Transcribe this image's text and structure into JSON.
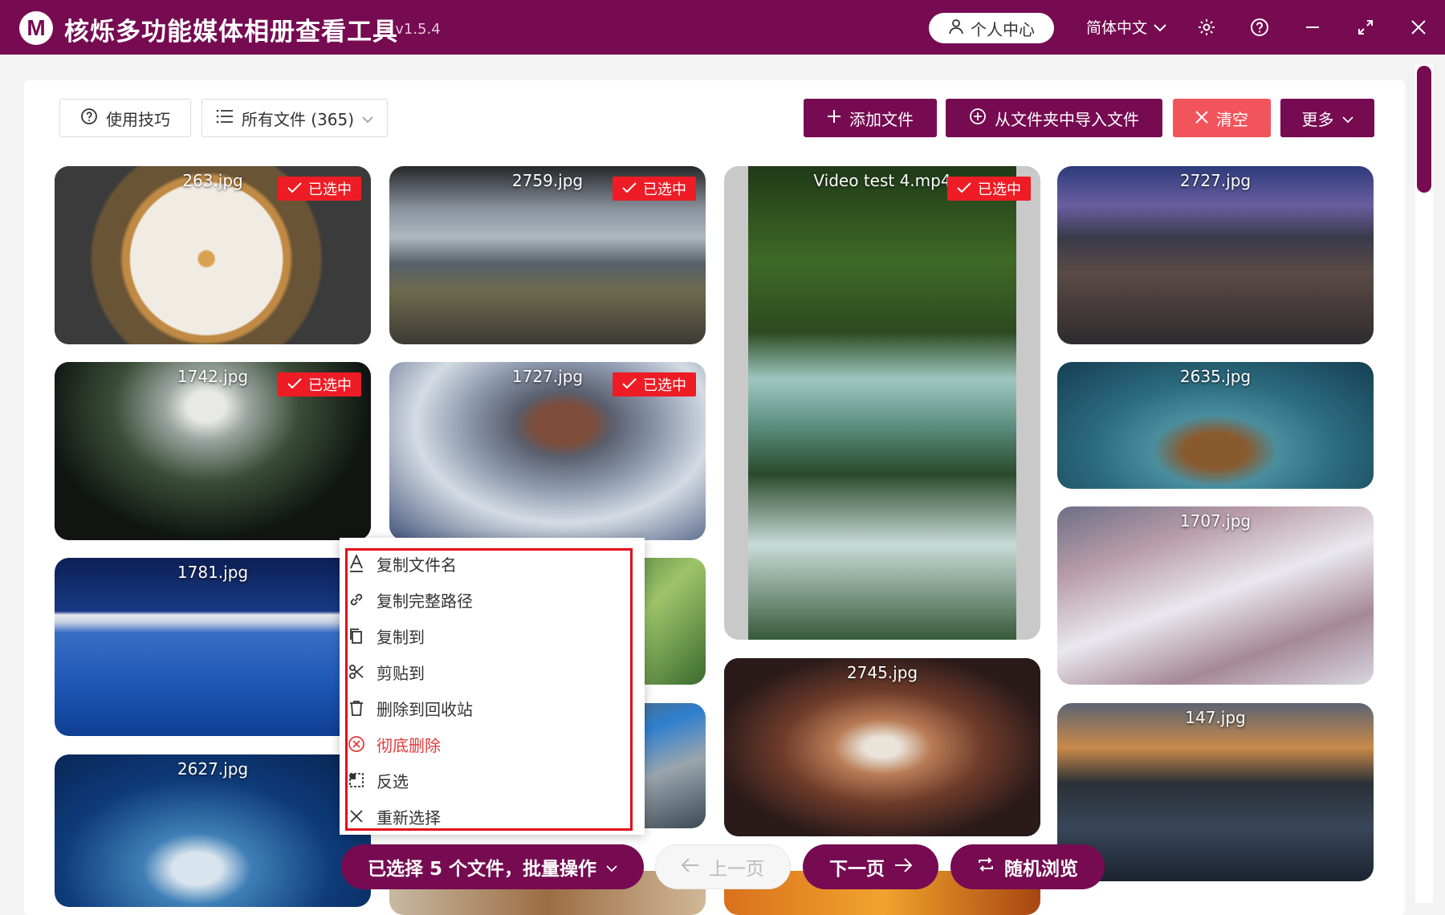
{
  "window": {
    "title": "核烁多功能媒体相册查看工具",
    "version": "- v1.5.4",
    "logo_letter": "M",
    "user_center": "个人中心",
    "language": "简体中文"
  },
  "toolbar": {
    "tips": "使用技巧",
    "filter": "所有文件 (365)",
    "add_files": "添加文件",
    "import_folder": "从文件夹中导入文件",
    "clear": "清空",
    "more": "更多"
  },
  "selected_badge": "已选中",
  "tiles": [
    {
      "name": "263.jpg",
      "selected": true
    },
    {
      "name": "2759.jpg",
      "selected": true
    },
    {
      "name": "Video test 4.mp4",
      "selected": true
    },
    {
      "name": "2727.jpg",
      "selected": false
    },
    {
      "name": "1742.jpg",
      "selected": true
    },
    {
      "name": "1727.jpg",
      "selected": true
    },
    {
      "name": "2635.jpg",
      "selected": false
    },
    {
      "name": "1781.jpg",
      "selected": false
    },
    {
      "name": "1707.jpg",
      "selected": false
    },
    {
      "name": "2745.jpg",
      "selected": false
    },
    {
      "name": "2627.jpg",
      "selected": false
    },
    {
      "name": "147.jpg",
      "selected": false
    }
  ],
  "context_menu": [
    {
      "label": "复制文件名",
      "icon": "font-a-icon"
    },
    {
      "label": "复制完整路径",
      "icon": "link-icon"
    },
    {
      "label": "复制到",
      "icon": "copy-icon"
    },
    {
      "label": "剪贴到",
      "icon": "scissors-icon"
    },
    {
      "label": "删除到回收站",
      "icon": "trash-icon"
    },
    {
      "label": "彻底删除",
      "icon": "delete-circle-icon",
      "danger": true
    },
    {
      "label": "反选",
      "icon": "invert-select-icon"
    },
    {
      "label": "重新选择",
      "icon": "close-icon"
    }
  ],
  "bottom_bar": {
    "batch": "已选择 5 个文件，批量操作",
    "prev": "上一页",
    "next": "下一页",
    "random": "随机浏览"
  },
  "colors": {
    "brand": "#760b52",
    "danger": "#ee1c25",
    "clear_button": "#f2545b"
  }
}
